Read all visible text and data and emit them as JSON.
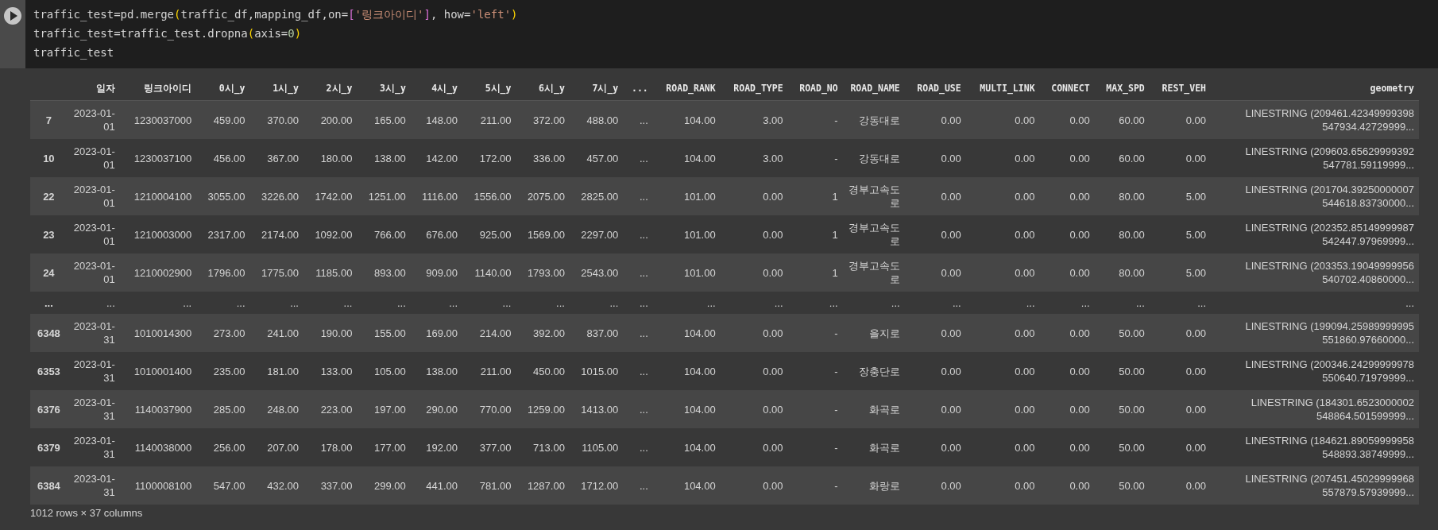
{
  "code_cell": {
    "lines": [
      [
        {
          "kind": "plain",
          "text": "traffic_test=pd.merge"
        },
        {
          "kind": "paren",
          "text": "("
        },
        {
          "kind": "plain",
          "text": "traffic_df,mapping_df,on="
        },
        {
          "kind": "bracket",
          "text": "["
        },
        {
          "kind": "string",
          "text": "'링크아이디'"
        },
        {
          "kind": "bracket",
          "text": "]"
        },
        {
          "kind": "plain",
          "text": ", how="
        },
        {
          "kind": "string",
          "text": "'left'"
        },
        {
          "kind": "paren",
          "text": ")"
        }
      ],
      [
        {
          "kind": "plain",
          "text": "traffic_test=traffic_test.dropna"
        },
        {
          "kind": "paren",
          "text": "("
        },
        {
          "kind": "plain",
          "text": "axis="
        },
        {
          "kind": "number",
          "text": "0"
        },
        {
          "kind": "paren",
          "text": ")"
        }
      ],
      [
        {
          "kind": "plain",
          "text": "traffic_test"
        }
      ]
    ]
  },
  "table": {
    "columns": [
      "일자",
      "링크아이디",
      "0시_y",
      "1시_y",
      "2시_y",
      "3시_y",
      "4시_y",
      "5시_y",
      "6시_y",
      "7시_y",
      "...",
      "ROAD_RANK",
      "ROAD_TYPE",
      "ROAD_NO",
      "ROAD_NAME",
      "ROAD_USE",
      "MULTI_LINK",
      "CONNECT",
      "MAX_SPD",
      "REST_VEH",
      "geometry"
    ],
    "rows": [
      {
        "index": "7",
        "cells": [
          "2023-01-01",
          "1230037000",
          "459.00",
          "370.00",
          "200.00",
          "165.00",
          "148.00",
          "211.00",
          "372.00",
          "488.00",
          "...",
          "104.00",
          "3.00",
          "-",
          "강동대로",
          "0.00",
          "0.00",
          "0.00",
          "60.00",
          "0.00",
          "LINESTRING (209461.42349999398 547934.42729999..."
        ]
      },
      {
        "index": "10",
        "cells": [
          "2023-01-01",
          "1230037100",
          "456.00",
          "367.00",
          "180.00",
          "138.00",
          "142.00",
          "172.00",
          "336.00",
          "457.00",
          "...",
          "104.00",
          "3.00",
          "-",
          "강동대로",
          "0.00",
          "0.00",
          "0.00",
          "60.00",
          "0.00",
          "LINESTRING (209603.65629999392 547781.59119999..."
        ]
      },
      {
        "index": "22",
        "cells": [
          "2023-01-01",
          "1210004100",
          "3055.00",
          "3226.00",
          "1742.00",
          "1251.00",
          "1116.00",
          "1556.00",
          "2075.00",
          "2825.00",
          "...",
          "101.00",
          "0.00",
          "1",
          "경부고속도로",
          "0.00",
          "0.00",
          "0.00",
          "80.00",
          "5.00",
          "LINESTRING (201704.39250000007 544618.83730000..."
        ]
      },
      {
        "index": "23",
        "cells": [
          "2023-01-01",
          "1210003000",
          "2317.00",
          "2174.00",
          "1092.00",
          "766.00",
          "676.00",
          "925.00",
          "1569.00",
          "2297.00",
          "...",
          "101.00",
          "0.00",
          "1",
          "경부고속도로",
          "0.00",
          "0.00",
          "0.00",
          "80.00",
          "5.00",
          "LINESTRING (202352.85149999987 542447.97969999..."
        ]
      },
      {
        "index": "24",
        "cells": [
          "2023-01-01",
          "1210002900",
          "1796.00",
          "1775.00",
          "1185.00",
          "893.00",
          "909.00",
          "1140.00",
          "1793.00",
          "2543.00",
          "...",
          "101.00",
          "0.00",
          "1",
          "경부고속도로",
          "0.00",
          "0.00",
          "0.00",
          "80.00",
          "5.00",
          "LINESTRING (203353.19049999956 540702.40860000..."
        ]
      },
      {
        "index": "...",
        "cells": [
          "...",
          "...",
          "...",
          "...",
          "...",
          "...",
          "...",
          "...",
          "...",
          "...",
          "...",
          "...",
          "...",
          "...",
          "...",
          "...",
          "...",
          "...",
          "...",
          "...",
          "..."
        ]
      },
      {
        "index": "6348",
        "cells": [
          "2023-01-31",
          "1010014300",
          "273.00",
          "241.00",
          "190.00",
          "155.00",
          "169.00",
          "214.00",
          "392.00",
          "837.00",
          "...",
          "104.00",
          "0.00",
          "-",
          "을지로",
          "0.00",
          "0.00",
          "0.00",
          "50.00",
          "0.00",
          "LINESTRING (199094.25989999995 551860.97660000..."
        ]
      },
      {
        "index": "6353",
        "cells": [
          "2023-01-31",
          "1010001400",
          "235.00",
          "181.00",
          "133.00",
          "105.00",
          "138.00",
          "211.00",
          "450.00",
          "1015.00",
          "...",
          "104.00",
          "0.00",
          "-",
          "장충단로",
          "0.00",
          "0.00",
          "0.00",
          "50.00",
          "0.00",
          "LINESTRING (200346.24299999978 550640.71979999..."
        ]
      },
      {
        "index": "6376",
        "cells": [
          "2023-01-31",
          "1140037900",
          "285.00",
          "248.00",
          "223.00",
          "197.00",
          "290.00",
          "770.00",
          "1259.00",
          "1413.00",
          "...",
          "104.00",
          "0.00",
          "-",
          "화곡로",
          "0.00",
          "0.00",
          "0.00",
          "50.00",
          "0.00",
          "LINESTRING (184301.6523000002 548864.501599999..."
        ]
      },
      {
        "index": "6379",
        "cells": [
          "2023-01-31",
          "1140038000",
          "256.00",
          "207.00",
          "178.00",
          "177.00",
          "192.00",
          "377.00",
          "713.00",
          "1105.00",
          "...",
          "104.00",
          "0.00",
          "-",
          "화곡로",
          "0.00",
          "0.00",
          "0.00",
          "50.00",
          "0.00",
          "LINESTRING (184621.89059999958 548893.38749999..."
        ]
      },
      {
        "index": "6384",
        "cells": [
          "2023-01-31",
          "1100008100",
          "547.00",
          "432.00",
          "337.00",
          "299.00",
          "441.00",
          "781.00",
          "1287.00",
          "1712.00",
          "...",
          "104.00",
          "0.00",
          "-",
          "화랑로",
          "0.00",
          "0.00",
          "0.00",
          "50.00",
          "0.00",
          "LINESTRING (207451.45029999968 557879.57939999..."
        ]
      }
    ]
  },
  "footer": "1012 rows × 37 columns"
}
